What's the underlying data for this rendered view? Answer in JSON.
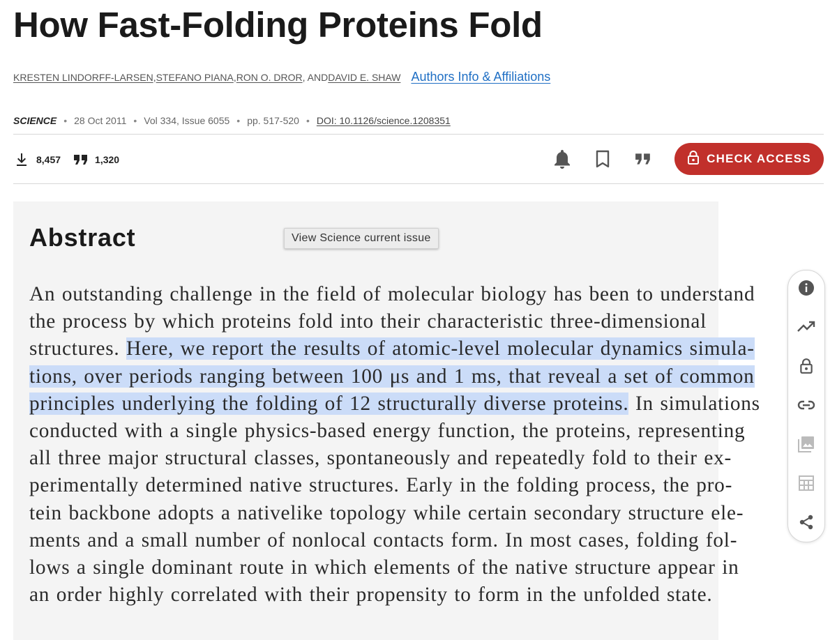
{
  "article": {
    "title": "How Fast-Folding Proteins Fold",
    "authors": [
      "KRESTEN LINDORFF-LARSEN",
      "STEFANO PIANA",
      "RON O. DROR",
      "DAVID E. SHAW"
    ],
    "author_separators": [
      " , ",
      " , ",
      ", AND "
    ],
    "affiliations_link": "Authors Info & Affiliations"
  },
  "meta": {
    "journal": "SCIENCE",
    "date": "28 Oct 2011",
    "volume_issue": "Vol 334, Issue 6055",
    "pages": "pp. 517-520",
    "doi": "DOI: 10.1126/science.1208351",
    "separator": "•"
  },
  "metrics": {
    "downloads": "8,457",
    "citations": "1,320"
  },
  "actions": {
    "alert_icon": "bell-icon",
    "bookmark_icon": "bookmark-icon",
    "cite_icon": "quote-icon",
    "check_access_label": "CHECK ACCESS",
    "accent_color": "#c1302b"
  },
  "abstract": {
    "heading": "Abstract",
    "tooltip": "View Science current issue",
    "lines": [
      {
        "before": "An outstanding challenge in the field of molecular biology has been to understand",
        "hl": "",
        "after": ""
      },
      {
        "before": "the process by which proteins fold into their characteristic three-dimensional",
        "hl": "",
        "after": ""
      },
      {
        "before": "structures. ",
        "hl": "Here, we report the results of atomic-level molecular dynamics simula-",
        "after": ""
      },
      {
        "before": "",
        "hl": "tions, over periods ranging between 100 μs and 1 ms, that reveal a set of common",
        "after": ""
      },
      {
        "before": "",
        "hl": "principles underlying the folding of 12 structurally diverse proteins.",
        "after": " In simulations"
      },
      {
        "before": "conducted with a single physics-based energy function, the proteins, representing",
        "hl": "",
        "after": ""
      },
      {
        "before": "all three major structural classes, spontaneously and repeatedly fold to their ex-",
        "hl": "",
        "after": ""
      },
      {
        "before": "perimentally determined native structures. Early in the folding process, the pro-",
        "hl": "",
        "after": ""
      },
      {
        "before": "tein backbone adopts a nativelike topology while certain secondary structure ele-",
        "hl": "",
        "after": ""
      },
      {
        "before": "ments and a small number of nonlocal contacts form. In most cases, folding fol-",
        "hl": "",
        "after": ""
      },
      {
        "before": "lows a single dominant route in which elements of the native structure appear in",
        "hl": "",
        "after": ""
      },
      {
        "before": "an order highly correlated with their propensity to form in the unfolded state.",
        "hl": "",
        "after": ""
      }
    ],
    "highlight_color": "#cbdcf8"
  },
  "sidebar": {
    "icons": [
      "info-icon",
      "trending-icon",
      "lock-icon",
      "link-icon",
      "image-icon",
      "table-icon",
      "share-icon"
    ]
  }
}
